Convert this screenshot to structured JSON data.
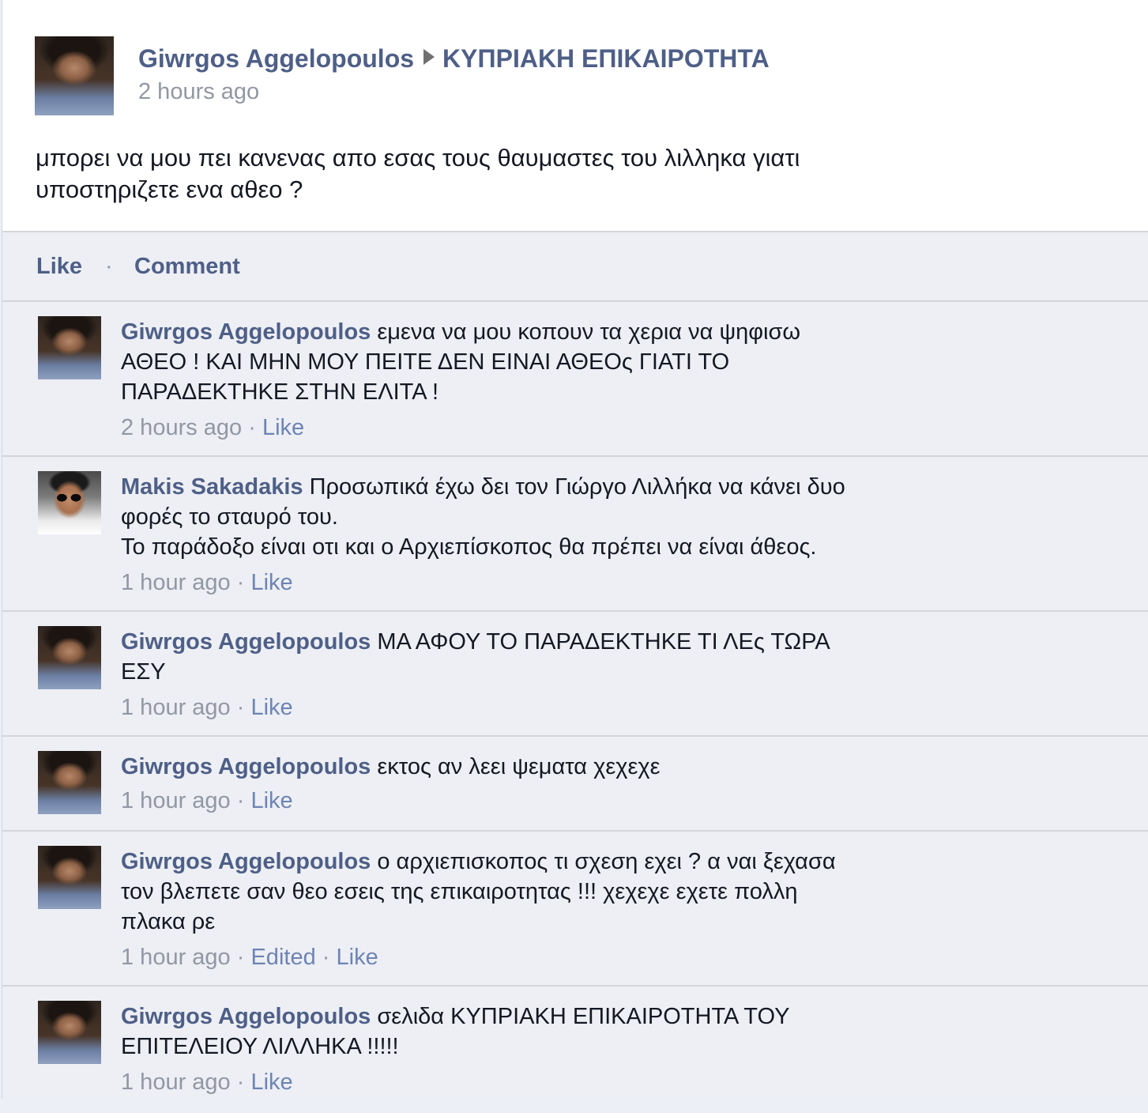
{
  "post": {
    "author": "Giwrgos Aggelopoulos",
    "target": "ΚΥΠΡΙΑΚΗ ΕΠΙΚΑΙΡΟΤΗΤΑ",
    "time": "2 hours ago",
    "text_line1": "μπορει να μου πει κανενας απο εσας τους θαυμαστες του λιλληκα γιατι",
    "text_line2": "υποστηριζετε ενα αθεο ?"
  },
  "actions": {
    "like": "Like",
    "separator": "·",
    "comment": "Comment"
  },
  "comments": [
    {
      "author": "Giwrgos Aggelopoulos",
      "text": "εμενα να μου κοπουν τα χερια να ψηφισω ΑΘΕΟ ! ΚΑΙ ΜΗΝ ΜΟΥ ΠΕΙΤΕ ΔΕΝ ΕΙΝΑΙ ΑΘΕΟς ΓΙΑΤΙ ΤΟ ΠΑΡΑΔΕΚΤΗΚΕ ΣΤΗΝ ΕΛΙΤΑ !",
      "time": "2 hours ago",
      "like": "Like"
    },
    {
      "author": "Makis Sakadakis",
      "text": "Προσωπικά έχω δει τον Γιώργο Λιλλήκα να κάνει δυο φορές το σταυρό του.",
      "text2": "Το παράδοξο είναι οτι και ο Αρχιεπίσκοπος θα πρέπει να είναι άθεος.",
      "time": "1 hour ago",
      "like": "Like"
    },
    {
      "author": "Giwrgos Aggelopoulos",
      "text": "ΜΑ ΑΦΟΥ ΤΟ ΠΑΡΑΔΕΚΤΗΚΕ ΤΙ ΛΕς ΤΩΡΑ ΕΣΥ",
      "time": "1 hour ago",
      "like": "Like"
    },
    {
      "author": "Giwrgos Aggelopoulos",
      "text": "εκτος αν λεει ψεματα χεχεχε",
      "time": "1 hour ago",
      "like": "Like"
    },
    {
      "author": "Giwrgos Aggelopoulos",
      "text": "ο αρχιεπισκοπος τι σχεση εχει ? α ναι ξεχασα τον βλεπετε σαν θεο εσεις της επικαιροτητας !!! χεχεχε εχετε πολλη πλακα ρε",
      "time": "1 hour ago",
      "edited": "Edited",
      "like": "Like"
    },
    {
      "author": "Giwrgos Aggelopoulos",
      "text": "σελιδα ΚΥΠΡΙΑΚΗ ΕΠΙΚΑΙΡΟΤΗΤΑ ΤΟΥ ΕΠΙΤΕΛΕΙΟΥ ΛΙΛΛΗΚΑ !!!!!",
      "time": "1 hour ago",
      "like": "Like"
    }
  ],
  "meta_separator": "·",
  "colors": {
    "link": "#4e5f87",
    "subtle_link": "#6d84b4",
    "meta": "#9197a3",
    "background": "#edeff4",
    "border": "#d3d6db"
  }
}
